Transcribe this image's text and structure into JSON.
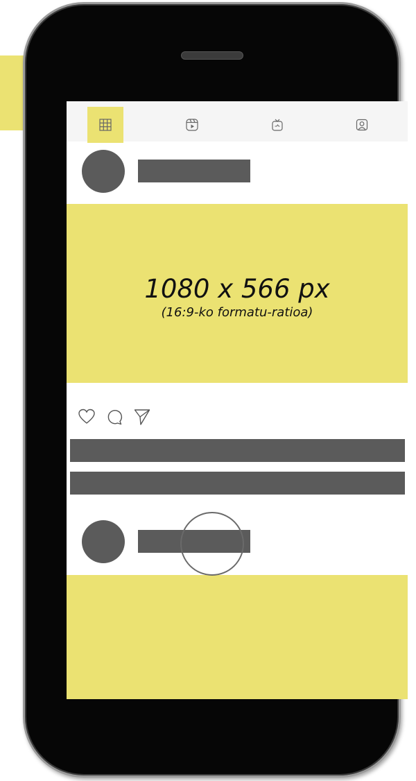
{
  "media": {
    "dimensions_label": "1080 x 566 px",
    "ratio_label": "(16:9-ko formatu-ratioa)"
  },
  "tabs": [
    {
      "icon": "grid-icon",
      "active": true
    },
    {
      "icon": "reels-icon",
      "active": false
    },
    {
      "icon": "igtv-icon",
      "active": false
    },
    {
      "icon": "tagged-icon",
      "active": false
    }
  ],
  "actions": [
    "heart-icon",
    "comment-icon",
    "share-icon"
  ],
  "colors": {
    "accent": "#ebe272",
    "placeholder": "#5b5b5b",
    "phone_body": "#060606",
    "tabbar_bg": "#f5f5f5"
  }
}
